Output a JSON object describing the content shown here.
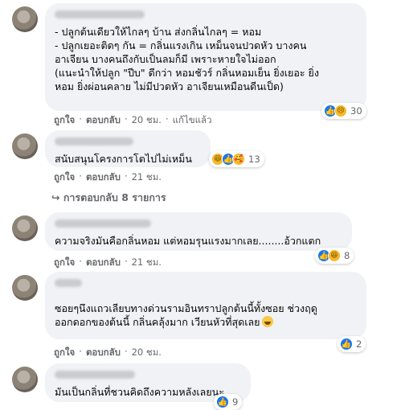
{
  "actions": {
    "like": "ถูกใจ",
    "reply": "ตอบกลับ",
    "sep": "·"
  },
  "comments": [
    {
      "text": "- ปลูกต้นเดียวให้ไกลๆ บ้าน ส่งกลิ่นไกลๆ = หอม\n- ปลูกเยอะติดๆ กัน = กลิ่นแรงเกิน เหม็นจนปวดหัว บางคน\nอาเจียน บางคนถึงกับเป็นลมก็มี เพราะหายใจไม่ออก\n(แนะนำให้ปลูก \"ปีบ\" ดีกว่า หอมชัวร์ กลิ่นหอมเย็น ยิ่งเยอะ ยิ่ง\nหอม ยิ่งผ่อนคลาย ไม่มีปวดหัว อาเจียนเหมือนดีนเป็ด)",
      "time": "20 ชม.",
      "edited": "แก้ไขแล้ว",
      "reaction_count": "30"
    },
    {
      "text": "สนับสนุนโครงการโตไปไม่เหม็น",
      "time": "21 ชม.",
      "reaction_count": "13",
      "replies_label": "การตอบกลับ 8 รายการ"
    },
    {
      "text": "ความจริงมันคือกลิ่นหอม แต่หอมรุนแรงมากเลย........อ้วกแตก",
      "time": "21 ชม.",
      "reaction_count": "8"
    },
    {
      "text": "ซอยๆนึงแถวเลียบทางด่วนรามอินทราปลูกต้นนี้ทั้งซอย ช่วงฤดู\nออกดอกของต้นนี้ กลิ่นคลุ้งมาก เวียนหัวที่สุดเลย",
      "time": "20 ชม.",
      "reaction_count": "2"
    },
    {
      "text": "มันเป็นกลิ่นที่ชวนคิดถึงความหลังเลยนะ",
      "reaction_count": "9"
    }
  ]
}
